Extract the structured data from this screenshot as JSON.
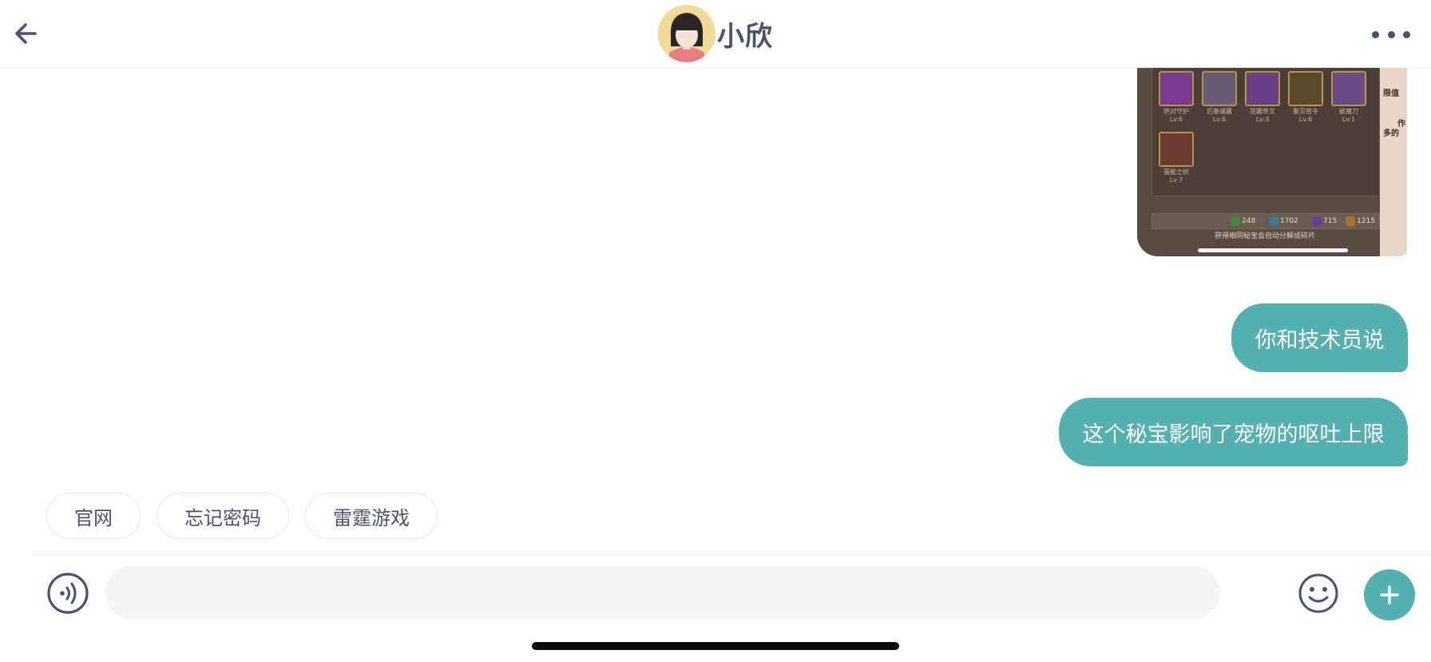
{
  "header": {
    "agent_name": "小欣",
    "back_icon": "arrow-left-icon",
    "more_icon": "more-horizontal-icon"
  },
  "image_message": {
    "items": [
      {
        "label": "绝对守护",
        "level": "Lv:6",
        "color": "#7a3b8f"
      },
      {
        "label": "后备储藏",
        "level": "Lv:6",
        "color": "#6a5a75"
      },
      {
        "label": "花瓣草叉",
        "level": "Lv:3",
        "color": "#6b3f86"
      },
      {
        "label": "聚灵密令",
        "level": "Lv:6",
        "color": "#5a4a2a"
      },
      {
        "label": "破魔刀",
        "level": "Lv:1",
        "color": "#6a4a82"
      },
      {
        "label": "蛋能之帜",
        "level": "Lv:7",
        "color": "#6b3b2f"
      }
    ],
    "currencies": [
      {
        "value": "248",
        "color": "#3f8a3a"
      },
      {
        "value": "1702",
        "color": "#3a78a0"
      },
      {
        "value": "715",
        "color": "#6a3a9a"
      },
      {
        "value": "1215",
        "color": "#b0702a"
      }
    ],
    "caption": "获得相同秘宝会自动分解成碎片",
    "side_text_1": "限值",
    "side_text_2": "作",
    "side_text_3": "多的"
  },
  "messages": [
    {
      "text": "你和技术员说",
      "sender": "me"
    },
    {
      "text": "这个秘宝影响了宠物的呕吐上限",
      "sender": "me"
    }
  ],
  "quick_replies": [
    "官网",
    "忘记密码",
    "雷霆游戏"
  ],
  "composer": {
    "placeholder": "",
    "value": "",
    "voice_icon": "voice-icon",
    "emoji_icon": "emoji-icon",
    "plus_icon": "plus-icon"
  },
  "colors": {
    "accent": "#54b1af",
    "text_dark": "#4a5170"
  }
}
